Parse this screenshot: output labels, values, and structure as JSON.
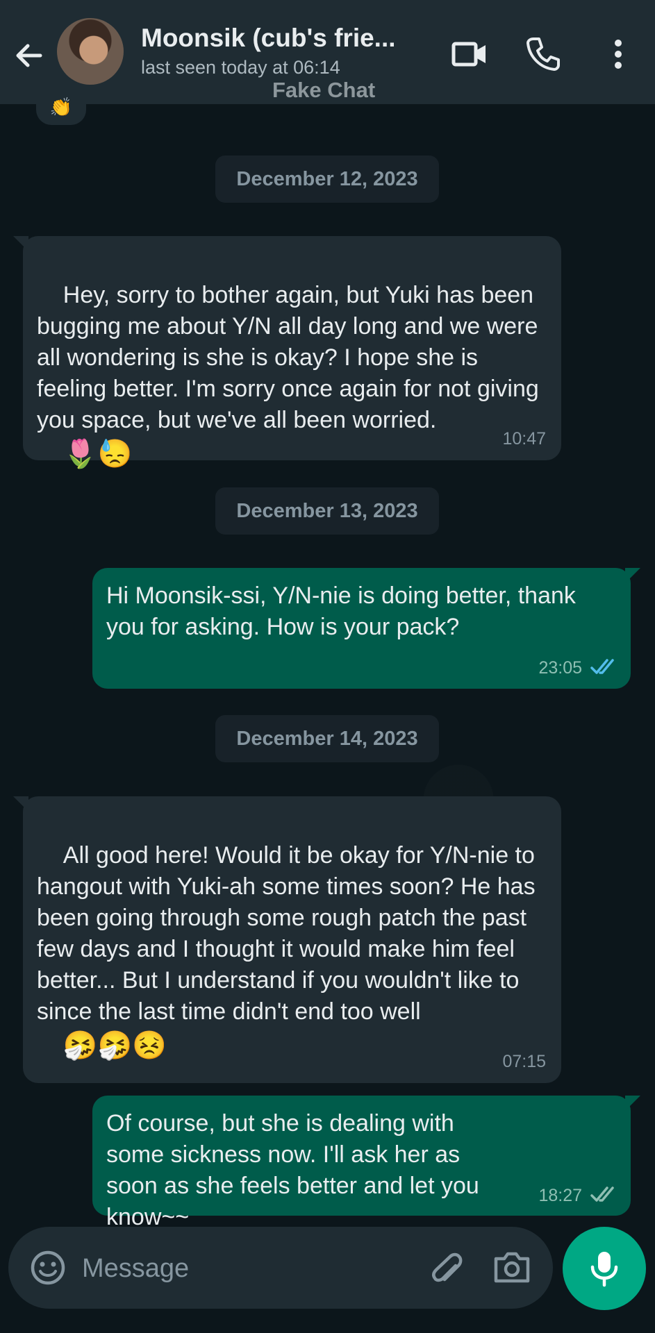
{
  "header": {
    "contact_name": "Moonsik (cub's frie...",
    "last_seen": "last seen today at 06:14",
    "overlay_label": "Fake Chat"
  },
  "messages": [
    {
      "type": "date",
      "label": "December 12, 2023"
    },
    {
      "type": "in",
      "text": "Hey, sorry to bother again, but Yuki has been bugging me about Y/N all day long and we were all wondering is she is okay? I hope she is feeling better. I'm sorry once again for not giving you space, but we've all been worried.",
      "emoji": "🌷😓",
      "time": "10:47"
    },
    {
      "type": "date",
      "label": "December 13, 2023"
    },
    {
      "type": "out",
      "text": "Hi Moonsik-ssi, Y/N-nie is doing better, thank you for asking. How is your pack?",
      "time": "23:05",
      "status": "read"
    },
    {
      "type": "date",
      "label": "December 14, 2023"
    },
    {
      "type": "in",
      "text": "All good here! Would it be okay for Y/N-nie to hangout with Yuki-ah some times soon? He has been going through some rough patch the past few days and I thought it would make him feel better... But I understand if you wouldn't like to since the last time didn't end too well",
      "emoji": "🤧🤧😣",
      "time": "07:15"
    },
    {
      "type": "out",
      "text": "Of course, but she is dealing with some sickness now. I'll ask her as soon as she feels better and let you know~~",
      "time": "18:27",
      "status": "delivered"
    }
  ],
  "reaction_emoji": "👏",
  "input": {
    "placeholder": "Message"
  },
  "colors": {
    "header_bg": "#1f2c33",
    "incoming_bubble": "#202c33",
    "outgoing_bubble": "#005c4b",
    "accent": "#00a884",
    "read_tick": "#53bdeb"
  },
  "icons": [
    "back-arrow-icon",
    "video-call-icon",
    "phone-icon",
    "more-vert-icon",
    "emoji-icon",
    "attach-icon",
    "camera-icon",
    "mic-icon",
    "double-check-icon"
  ]
}
